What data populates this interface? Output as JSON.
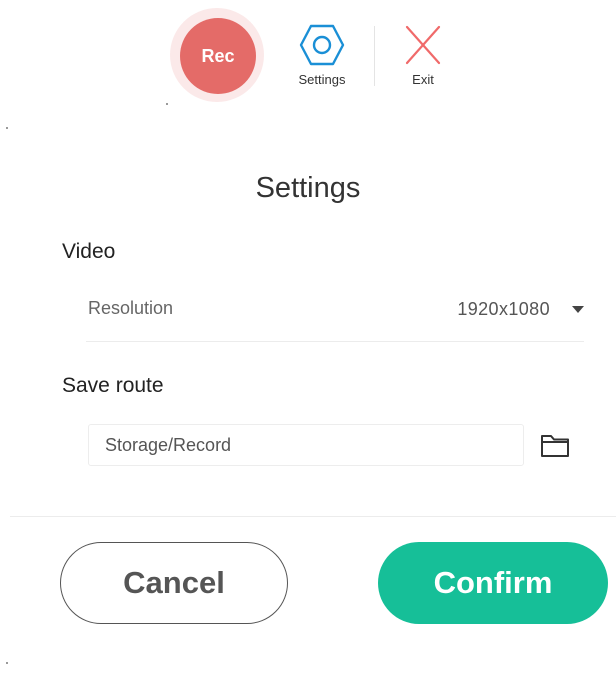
{
  "toolbar": {
    "record_label": "Rec",
    "settings_label": "Settings",
    "exit_label": "Exit",
    "record_color": "#e46b68",
    "settings_icon_color": "#1a8fd6",
    "exit_icon_color": "#f06a6a"
  },
  "dialog": {
    "title": "Settings",
    "video_section": {
      "heading": "Video",
      "resolution_label": "Resolution",
      "resolution_value": "1920x1080"
    },
    "save_section": {
      "heading": "Save route",
      "path_value": "Storage/Record"
    },
    "cancel_label": "Cancel",
    "confirm_label": "Confirm",
    "confirm_color": "#16bf98"
  },
  "icons": {
    "settings": "hexagon-gear-icon",
    "exit": "close-icon",
    "folder": "folder-icon",
    "dropdown": "caret-down-icon"
  }
}
